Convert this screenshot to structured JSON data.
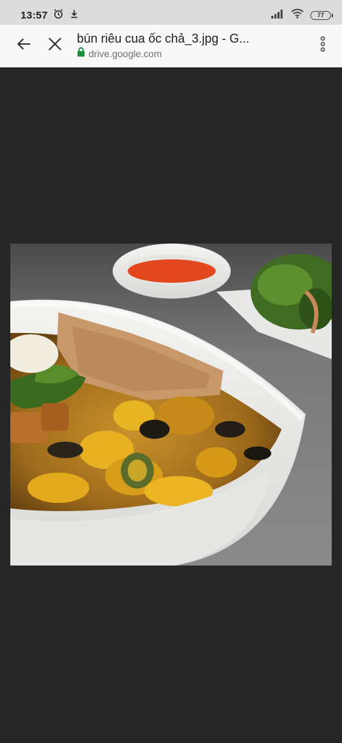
{
  "status_bar": {
    "time": "13:57",
    "battery": "77",
    "icons": [
      "alarm-icon",
      "download-icon",
      "signal-icon",
      "wifi-icon",
      "battery-icon"
    ]
  },
  "toolbar": {
    "title": "bún riêu cua ốc chả_3.jpg - G...",
    "url": "drive.google.com",
    "icons": [
      "back-arrow-icon",
      "close-icon",
      "lock-icon",
      "more-vert-icon"
    ]
  },
  "colors": {
    "background": "#262626",
    "toolbar": "#f8f8f8",
    "status_bar": "#dcdcdc",
    "lock": "#1e8e3e"
  }
}
